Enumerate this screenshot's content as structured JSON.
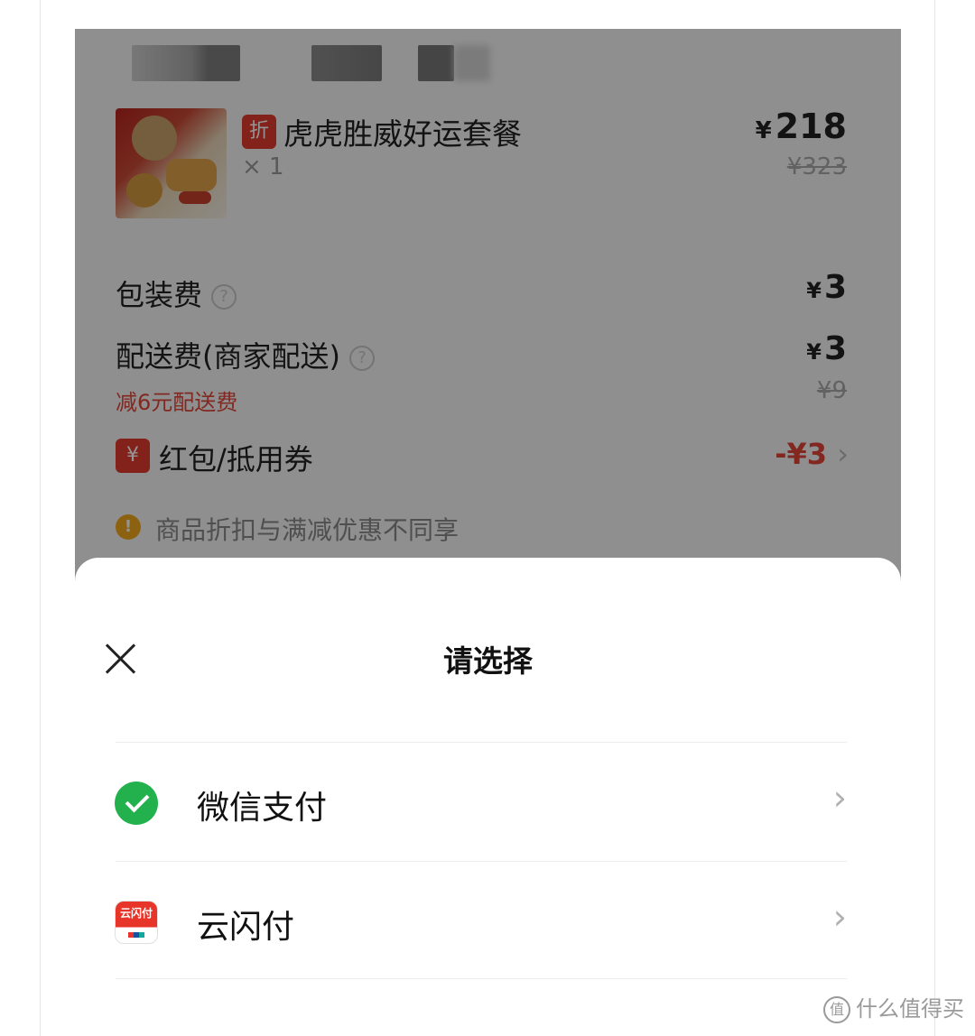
{
  "order": {
    "item": {
      "discount_tag": "折",
      "name": "虎虎胜威好运套餐",
      "qty": "× 1",
      "price_symbol": "¥",
      "price": "218",
      "original_price": "¥323"
    },
    "packaging": {
      "label": "包装费",
      "value_symbol": "¥",
      "value": "3"
    },
    "delivery": {
      "label": "配送费(商家配送)",
      "value_symbol": "¥",
      "value": "3",
      "subtext": "减6元配送费",
      "original": "¥9"
    },
    "coupon": {
      "icon_glyph": "¥",
      "label": "红包/抵用券",
      "value": "-¥3",
      "chevron": "›"
    },
    "notice": {
      "icon_glyph": "!",
      "text": "商品折扣与满减优惠不同享"
    },
    "help_glyph": "?"
  },
  "sheet": {
    "title": "请选择",
    "options": [
      {
        "label": "微信支付",
        "icon": "wechat-pay-icon",
        "chevron": "›"
      },
      {
        "label": "云闪付",
        "icon": "yunshanfu-icon",
        "icon_text": "云闪付",
        "chevron": "›"
      }
    ]
  },
  "watermark": {
    "icon_glyph": "值",
    "text": "什么值得买"
  },
  "colors": {
    "accent_red": "#e03b2d",
    "wechat_green": "#22b14c",
    "notice_orange": "#f2a81d"
  }
}
